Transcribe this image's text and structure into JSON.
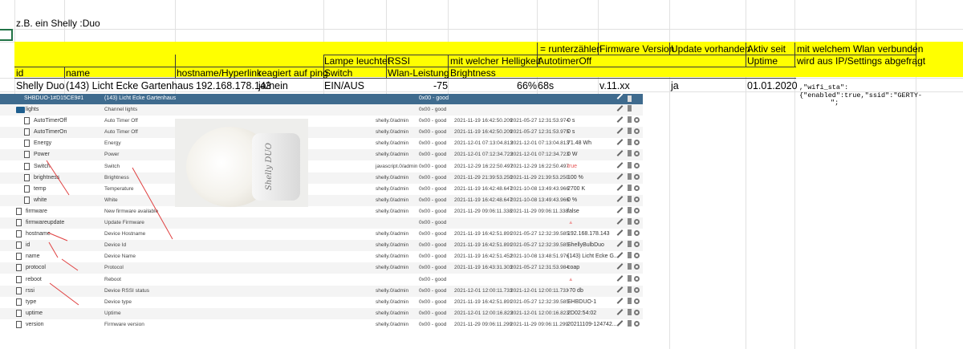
{
  "sheet": {
    "note": "z.B. ein Shelly :Duo",
    "header_row1": {
      "runterzaehlen": "= runterzählen",
      "firmware": "Firmware Version",
      "update": "Update vorhanden",
      "aktiv": "Aktiv seit",
      "wlan1": "mit welchem Wlan verbunden"
    },
    "header_row2": {
      "lampe": "Lampe leuchtet",
      "rssi": "RSSI",
      "helligkeit": "mit welcher Helligkeit",
      "autotimer": "AutotimerOff",
      "uptime": "Uptime",
      "wlan2": "wird aus IP/Settings abgefragt"
    },
    "header_row3": {
      "id": "id",
      "name": "name",
      "hostname": "hostname/Hyperlink",
      "ping": "reagiert auf ping",
      "switch": "Switch",
      "wlan": "Wlan-Leistung",
      "brightness": "Brightness"
    },
    "data_row": {
      "id": "Shelly Duo",
      "name": "(143) Licht Ecke Gartenhaus",
      "host": "192.168.178.143",
      "ping": "ja/nein",
      "switch": "EIN/AUS",
      "rssi": "-75",
      "brightness": "66%",
      "timer": "68s",
      "firmware": "v.11.xx",
      "update": "ja",
      "date": "01.01.2020",
      "wifi": ",\"wifi_sta\":{\"enabled\":true,\"ssid\":\"GERTY-",
      "wifi2": "\";"
    }
  },
  "panel": {
    "header": {
      "id": "SHBDUO-1#D15CE9#1",
      "name": "(143) Licht Ecke Gartenhaus",
      "q": "0x00 - good"
    },
    "bulb_label": "Shelly DUO",
    "rows": [
      {
        "n": "lights",
        "d": "Channel lights",
        "r": "",
        "q": "0x00 - good",
        "ts": "",
        "lc": "",
        "v": "",
        "ind": 1,
        "folder": true
      },
      {
        "n": "AutoTimerOff",
        "d": "Auto Timer Off",
        "r": "shelly.0/admin",
        "q": "0x00 - good",
        "ts": "2021-11-19 16:42:50.209",
        "lc": "2021-05-27 12:31:53.974",
        "v": "0 s",
        "ind": 2
      },
      {
        "n": "AutoTimerOn",
        "d": "Auto Timer Off",
        "r": "shelly.0/admin",
        "q": "0x00 - good",
        "ts": "2021-11-19 16:42:50.209",
        "lc": "2021-05-27 12:31:53.975",
        "v": "0 s",
        "ind": 2
      },
      {
        "n": "Energy",
        "d": "Energy",
        "r": "shelly.0/admin",
        "q": "0x00 - good",
        "ts": "2021-12-01 07:13:04.813",
        "lc": "2021-12-01 07:13:04.813",
        "v": "71.48 Wh",
        "ind": 2
      },
      {
        "n": "Power",
        "d": "Power",
        "r": "shelly.0/admin",
        "q": "0x00 - good",
        "ts": "2021-12-01 07:12:34.723",
        "lc": "2021-12-01 07:12:34.723",
        "v": "0 W",
        "ind": 2
      },
      {
        "n": "Switch",
        "d": "Switch",
        "r": "javascript.0/admin",
        "q": "0x00 - good",
        "ts": "2021-12-29 16:22:50.497",
        "lc": "2021-12-29 16:22:50.497",
        "v": "true",
        "ind": 2,
        "red": true
      },
      {
        "n": "brightness",
        "d": "Brightness",
        "r": "shelly.0/admin",
        "q": "0x00 - good",
        "ts": "2021-11-29 21:39:53.250",
        "lc": "2021-11-29 21:39:53.250",
        "v": "100 %",
        "ind": 2
      },
      {
        "n": "temp",
        "d": "Temperature",
        "r": "shelly.0/admin",
        "q": "0x00 - good",
        "ts": "2021-11-19 16:42:48.647",
        "lc": "2021-10-08 13:49:43.966",
        "v": "2700 K",
        "ind": 2
      },
      {
        "n": "white",
        "d": "White",
        "r": "shelly.0/admin",
        "q": "0x00 - good",
        "ts": "2021-11-19 16:42:48.647",
        "lc": "2021-10-08 13:49:43.966",
        "v": "0 %",
        "ind": 2
      },
      {
        "n": "firmware",
        "d": "New firmware available",
        "r": "shelly.0/admin",
        "q": "0x00 - good",
        "ts": "2021-11-29 09:06:11.338",
        "lc": "2021-11-29 09:06:11.338",
        "v": "false",
        "ind": 1
      },
      {
        "n": "firmwareupdate",
        "d": "Update Firmware",
        "r": "",
        "q": "0x00 - good",
        "ts": "",
        "lc": "",
        "v": "",
        "ind": 1,
        "warn": true
      },
      {
        "n": "hostname",
        "d": "Device Hostname",
        "r": "shelly.0/admin",
        "q": "0x00 - good",
        "ts": "2021-11-19 16:42:51.891",
        "lc": "2021-05-27 12:32:39.585",
        "v": "192.168.178.143",
        "ind": 1
      },
      {
        "n": "id",
        "d": "Device Id",
        "r": "shelly.0/admin",
        "q": "0x00 - good",
        "ts": "2021-11-19 16:42:51.891",
        "lc": "2021-05-27 12:32:39.585",
        "v": "ShellyBulbDuo",
        "ind": 1
      },
      {
        "n": "name",
        "d": "Device Name",
        "r": "shelly.0/admin",
        "q": "0x00 - good",
        "ts": "2021-11-19 16:42:51.452",
        "lc": "2021-10-08 13:48:51.976",
        "v": "(143) Licht Ecke G...",
        "ind": 1
      },
      {
        "n": "protocol",
        "d": "Protocol",
        "r": "shelly.0/admin",
        "q": "0x00 - good",
        "ts": "2021-11-19 16:43:31.303",
        "lc": "2021-05-27 12:31:53.984",
        "v": "coap",
        "ind": 1
      },
      {
        "n": "reboot",
        "d": "Reboot",
        "r": "",
        "q": "0x00 - good",
        "ts": "",
        "lc": "",
        "v": "",
        "ind": 1,
        "warn": true
      },
      {
        "n": "rssi",
        "d": "Device RSSI status",
        "r": "shelly.0/admin",
        "q": "0x00 - good",
        "ts": "2021-12-01 12:00:11.733",
        "lc": "2021-12-01 12:00:11.733",
        "v": "-70 db",
        "ind": 1
      },
      {
        "n": "type",
        "d": "Device type",
        "r": "shelly.0/admin",
        "q": "0x00 - good",
        "ts": "2021-11-19 16:42:51.891",
        "lc": "2021-05-27 12:32:39.585",
        "v": "SHBDUO-1",
        "ind": 1
      },
      {
        "n": "uptime",
        "d": "Uptime",
        "r": "shelly.0/admin",
        "q": "0x00 - good",
        "ts": "2021-12-01 12:00:16.823",
        "lc": "2021-12-01 12:00:16.823",
        "v": "2D02:54:02",
        "ind": 1
      },
      {
        "n": "version",
        "d": "Firmware version",
        "r": "shelly.0/admin",
        "q": "0x00 - good",
        "ts": "2021-11-29 09:06:11.299",
        "lc": "2021-11-29 09:06:11.299",
        "v": "20211109-124742...",
        "ind": 1
      }
    ]
  }
}
